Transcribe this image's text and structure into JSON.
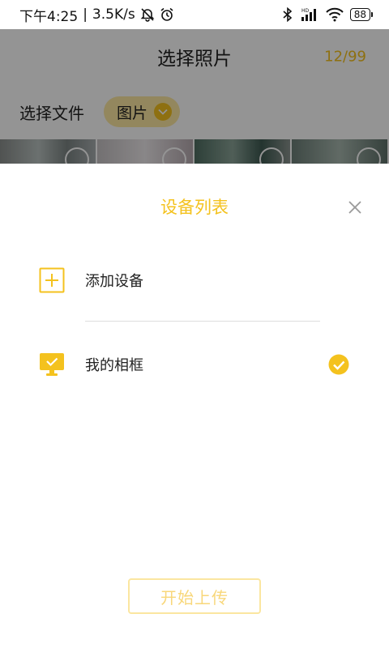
{
  "status_bar": {
    "time": "下午4:25",
    "separator": "|",
    "speed": "3.5K/s",
    "battery": "88"
  },
  "background_page": {
    "title": "选择照片",
    "counter": "12/99",
    "filter_label": "选择文件",
    "filter_value": "图片"
  },
  "sheet": {
    "title": "设备列表",
    "devices": [
      {
        "label": "添加设备",
        "icon": "add-square-icon",
        "selected": false
      },
      {
        "label": "我的相框",
        "icon": "photo-frame-icon",
        "selected": true
      }
    ],
    "upload_button": "开始上传"
  },
  "colors": {
    "accent": "#f4c21e",
    "accent_light": "#fbe6a0",
    "disabled_text": "#f8d77a",
    "overlay": "rgba(0,0,0,0.42)"
  }
}
